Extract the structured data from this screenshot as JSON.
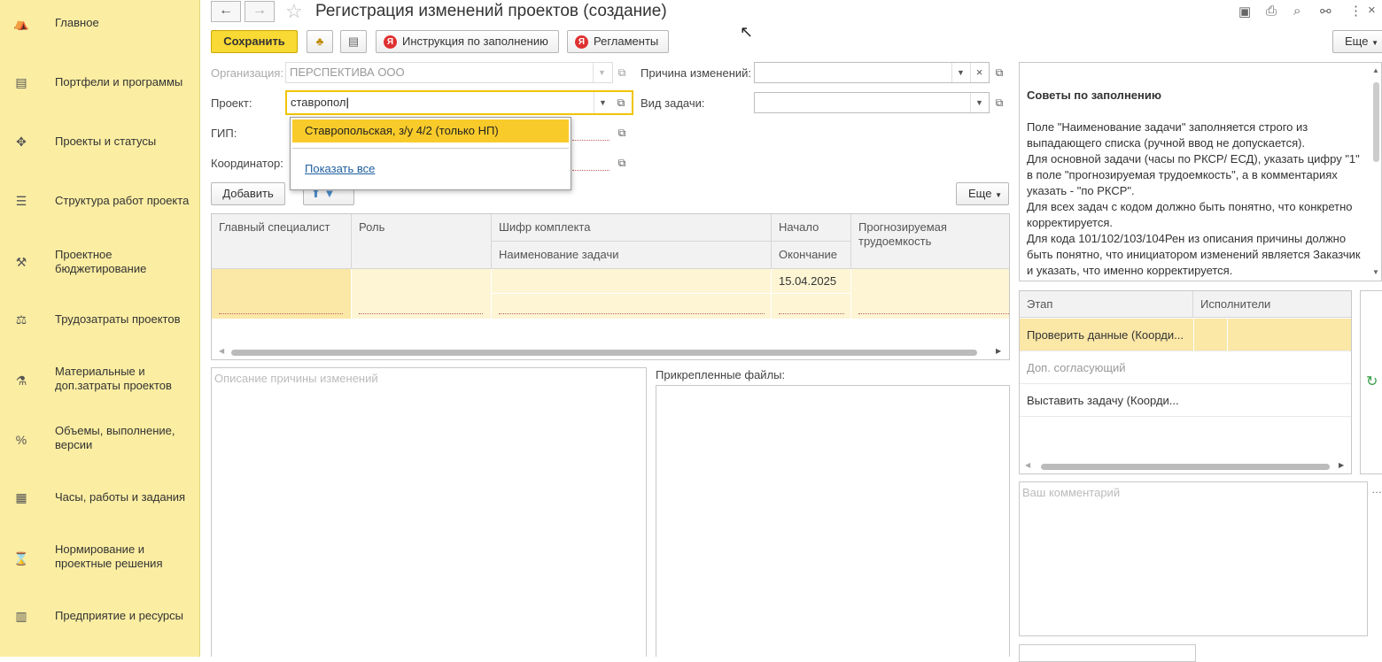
{
  "sidebar": {
    "items": [
      {
        "label": "Главное",
        "icon": "home-icon"
      },
      {
        "label": "Портфели и программы",
        "icon": "portfolio-icon"
      },
      {
        "label": "Проекты и статусы",
        "icon": "projects-icon"
      },
      {
        "label": "Структура работ проекта",
        "icon": "structure-icon"
      },
      {
        "label": "Проектное бюджетирование",
        "icon": "budget-icon"
      },
      {
        "label": "Трудозатраты проектов",
        "icon": "labor-icon"
      },
      {
        "label": "Материальные и доп.затраты проектов",
        "icon": "materials-icon"
      },
      {
        "label": "Объемы, выполнение, версии",
        "icon": "percent-icon"
      },
      {
        "label": "Часы, работы и задания",
        "icon": "calendar-icon"
      },
      {
        "label": "Нормирование и проектные решения",
        "icon": "norm-icon"
      },
      {
        "label": "Предприятие и ресурсы",
        "icon": "enterprise-icon"
      }
    ]
  },
  "header": {
    "title": "Регистрация изменений проектов (создание)"
  },
  "toolbar": {
    "save": "Сохранить",
    "instruction": "Инструкция по заполнению",
    "regulations": "Регламенты",
    "more": "Еще"
  },
  "form": {
    "org_label": "Организация:",
    "org_value": "ПЕРСПЕКТИВА ООО",
    "project_label": "Проект:",
    "project_value": "ставропол",
    "gip_label": "ГИП:",
    "coord_label": "Координатор:",
    "reason_label": "Причина изменений:",
    "tasktype_label": "Вид задачи:"
  },
  "dropdown": {
    "option": "Ставропольская, з/у 4/2 (только НП)",
    "show_all": "Показать все"
  },
  "tasks": {
    "add": "Добавить",
    "more": "Еще",
    "columns": {
      "specialist": "Главный специалист",
      "role": "Роль",
      "cipher": "Шифр комплекта",
      "task_name": "Наименование задачи",
      "start": "Начало",
      "end": "Окончание",
      "effort": "Прогнозируемая трудоемкость"
    },
    "row": {
      "start": "15.04.2025"
    }
  },
  "description_placeholder": "Описание причины изменений",
  "attached_files": "Прикрепленные файлы:",
  "tips": {
    "title": "Советы по заполнению",
    "lines": [
      "Поле \"Наименование задачи\" заполняется строго из выпадающего списка (ручной ввод не допускается).",
      "Для основной задачи (часы по РКСР/ ЕСД), указать цифру \"1\" в поле \"прогнозируемая трудоемкость\", а в комментариях указать - \"по РКСР\".",
      "Для всех задач с кодом должно быть понятно, что конкретно корректируется.",
      "Для кода 101/102/103/104Рен из описания причины должно быть понятно, что инициатором изменений является Заказчик и указать, что именно корректируется."
    ]
  },
  "stages": {
    "col_stage": "Этап",
    "col_exec": "Исполнители",
    "rows": [
      "Проверить данные (Коорди...",
      "Доп. согласующий",
      "Выставить задачу (Коорди..."
    ]
  },
  "comment_placeholder": "Ваш комментарий"
}
